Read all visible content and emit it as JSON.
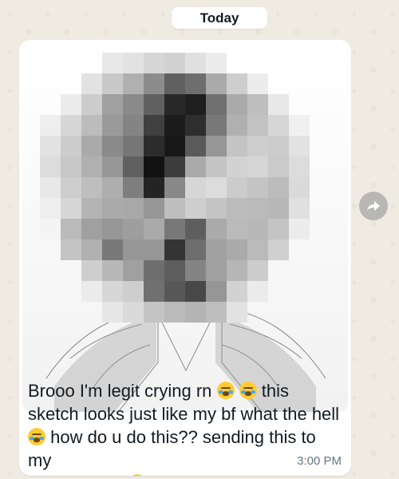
{
  "date_divider": {
    "label": "Today"
  },
  "message": {
    "text_parts": [
      "Brooo I'm legit crying rn ",
      " this\nsketch looks just like my bf what the hell\n",
      " how do u do this?? sending this to my\nfriends asap "
    ],
    "emojis": {
      "crying": "😭",
      "laughing": "😂",
      "heart": "❤️"
    },
    "timestamp": "3:00 PM",
    "image": {
      "type": "pixelated-photo-sketch",
      "grid_cols": 16,
      "grid_rows": 13,
      "gray_levels": [
        [
          255,
          255,
          255,
          255,
          232,
          226,
          214,
          210,
          224,
          236,
          255,
          255,
          255,
          255,
          255,
          255
        ],
        [
          255,
          255,
          255,
          226,
          200,
          176,
          140,
          96,
          110,
          170,
          206,
          236,
          255,
          255,
          255,
          255
        ],
        [
          255,
          255,
          236,
          204,
          160,
          138,
          96,
          40,
          30,
          112,
          170,
          190,
          232,
          255,
          255,
          255
        ],
        [
          255,
          238,
          214,
          188,
          154,
          132,
          64,
          28,
          46,
          120,
          176,
          194,
          214,
          240,
          255,
          255
        ],
        [
          255,
          226,
          204,
          170,
          138,
          118,
          44,
          24,
          90,
          150,
          196,
          206,
          204,
          226,
          255,
          255
        ],
        [
          255,
          220,
          200,
          176,
          150,
          96,
          18,
          60,
          170,
          196,
          210,
          214,
          202,
          220,
          255,
          255
        ],
        [
          255,
          232,
          206,
          190,
          174,
          126,
          36,
          136,
          214,
          220,
          204,
          196,
          188,
          218,
          255,
          255
        ],
        [
          255,
          238,
          214,
          180,
          170,
          168,
          150,
          190,
          206,
          196,
          188,
          186,
          184,
          224,
          255,
          255
        ],
        [
          255,
          244,
          186,
          160,
          150,
          158,
          170,
          120,
          94,
          170,
          186,
          184,
          196,
          236,
          255,
          255
        ],
        [
          255,
          255,
          196,
          176,
          120,
          150,
          150,
          52,
          110,
          160,
          170,
          186,
          208,
          255,
          255,
          255
        ],
        [
          255,
          255,
          255,
          206,
          184,
          160,
          110,
          94,
          132,
          160,
          182,
          204,
          255,
          255,
          255,
          255
        ],
        [
          255,
          255,
          255,
          235,
          214,
          206,
          112,
          88,
          72,
          150,
          210,
          235,
          255,
          255,
          255,
          255
        ],
        [
          255,
          255,
          255,
          255,
          230,
          218,
          196,
          186,
          180,
          190,
          226,
          255,
          255,
          255,
          255,
          255
        ]
      ]
    }
  },
  "actions": {
    "forward_icon_name": "forward-arrow-icon"
  },
  "colors": {
    "chat_background": "#efeae2",
    "bubble": "#ffffff",
    "text": "#111b21",
    "timestamp": "#667781"
  }
}
